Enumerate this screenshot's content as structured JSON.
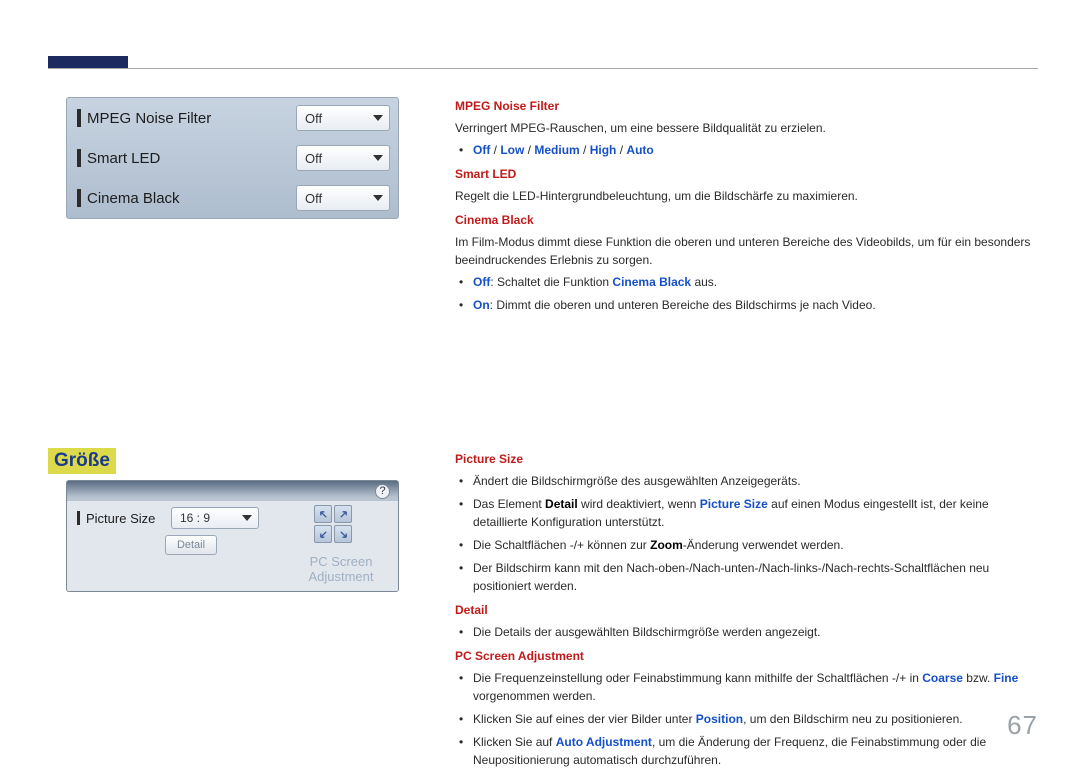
{
  "page_number": "67",
  "section_heading": "Größe",
  "panel1": {
    "rows": [
      {
        "label": "MPEG Noise Filter",
        "value": "Off"
      },
      {
        "label": "Smart LED",
        "value": "Off"
      },
      {
        "label": "Cinema Black",
        "value": "Off"
      }
    ]
  },
  "panel2": {
    "help": "?",
    "picture_size_label": "Picture Size",
    "picture_size_value": "16 : 9",
    "detail_label": "Detail",
    "pcscreen_line1": "PC Screen",
    "pcscreen_line2": "Adjustment"
  },
  "doc1": {
    "mpeg_heading": "MPEG Noise Filter",
    "mpeg_desc": "Verringert MPEG-Rauschen, um eine bessere Bildqualität zu erzielen.",
    "mpeg_opt_off": "Off",
    "mpeg_opt_low": "Low",
    "mpeg_opt_medium": "Medium",
    "mpeg_opt_high": "High",
    "mpeg_opt_auto": "Auto",
    "smartled_heading": "Smart LED",
    "smartled_desc": "Regelt die LED-Hintergrundbeleuchtung, um die Bildschärfe zu maximieren.",
    "cinema_heading": "Cinema Black",
    "cinema_desc": "Im Film-Modus dimmt diese Funktion die oberen und unteren Bereiche des Videobilds, um für ein besonders beeindruckendes Erlebnis zu sorgen.",
    "cinema_off_label": "Off",
    "cinema_off_text": ": Schaltet die Funktion ",
    "cinema_off_ref": "Cinema Black",
    "cinema_off_tail": " aus.",
    "cinema_on_label": "On",
    "cinema_on_text": ": Dimmt die oberen und unteren Bereiche des Bildschirms je nach Video."
  },
  "doc2": {
    "picsize_heading": "Picture Size",
    "picsize_b1": "Ändert die Bildschirmgröße des ausgewählten Anzeigegeräts.",
    "picsize_b2_a": "Das Element ",
    "picsize_b2_detail": "Detail",
    "picsize_b2_b": " wird deaktiviert, wenn ",
    "picsize_b2_ps": "Picture Size",
    "picsize_b2_c": " auf einen Modus eingestellt ist, der keine detaillierte Konfiguration unterstützt.",
    "picsize_b3_a": "Die Schaltflächen -/+ können zur ",
    "picsize_b3_zoom": "Zoom",
    "picsize_b3_b": "-Änderung verwendet werden.",
    "picsize_b4": "Der Bildschirm kann mit den Nach-oben-/Nach-unten-/Nach-links-/Nach-rechts-Schaltflächen neu positioniert werden.",
    "detail_heading": "Detail",
    "detail_b1": "Die Details der ausgewählten Bildschirmgröße werden angezeigt.",
    "pcadj_heading": "PC Screen Adjustment",
    "pcadj_b1_a": "Die Frequenzeinstellung oder Feinabstimmung kann mithilfe der Schaltflächen -/+ in ",
    "pcadj_b1_coarse": "Coarse",
    "pcadj_b1_b": " bzw. ",
    "pcadj_b1_fine": "Fine",
    "pcadj_b1_c": " vorgenommen werden.",
    "pcadj_b2_a": "Klicken Sie auf eines der vier Bilder unter ",
    "pcadj_b2_pos": "Position",
    "pcadj_b2_b": ", um den Bildschirm neu zu positionieren.",
    "pcadj_b3_a": "Klicken Sie auf ",
    "pcadj_b3_auto": "Auto Adjustment",
    "pcadj_b3_b": ", um die Änderung der Frequenz, die Feinabstimmung oder die Neupositionierung automatisch durchzuführen."
  }
}
